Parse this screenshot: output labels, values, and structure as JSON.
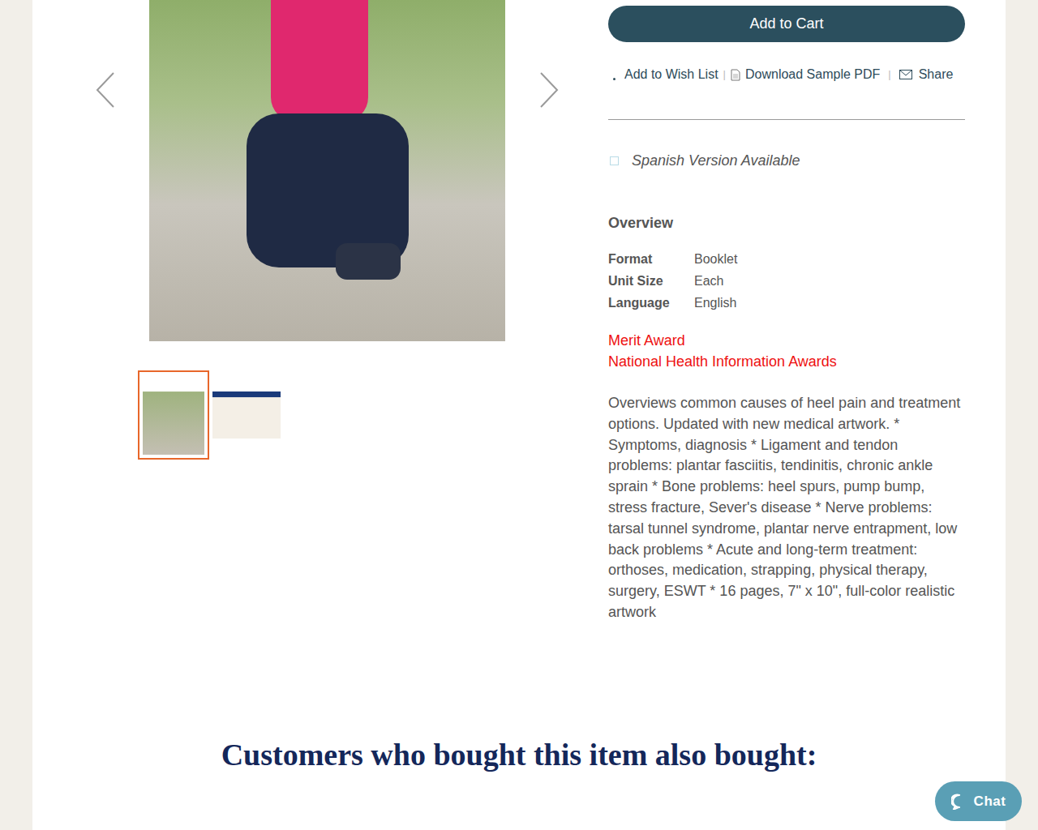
{
  "thumbnails": [
    {
      "selected": true
    },
    {
      "selected": false
    }
  ],
  "cart_button": "Add to Cart",
  "actions": {
    "wish_list": "Add to Wish List",
    "separator_1": "|",
    "download": "Download Sample PDF",
    "separator_2": "|",
    "share": "Share"
  },
  "spanish": {
    "label": "Spanish Version Available",
    "checked": false
  },
  "overview": {
    "title": "Overview",
    "rows": [
      {
        "label": "Format",
        "value": "Booklet"
      },
      {
        "label": "Unit Size",
        "value": "Each"
      },
      {
        "label": "Language",
        "value": "English"
      }
    ]
  },
  "awards": [
    "Merit Award",
    "National Health Information Awards"
  ],
  "description": "Overviews common causes of heel pain and treatment options. Updated with new medical artwork. * Symptoms, diagnosis * Ligament and tendon problems: plantar fasciitis, tendinitis, chronic ankle sprain * Bone problems: heel spurs, pump bump, stress fracture, Sever's disease * Nerve problems: tarsal tunnel syndrome, plantar nerve entrapment, low back problems * Acute and long-term treatment: orthoses, medication, strapping, physical therapy, surgery, ESWT * 16 pages, 7\" x 10\", full-color realistic artwork",
  "related_heading": "Customers who bought this item also bought:",
  "chat": {
    "label": "Chat"
  }
}
